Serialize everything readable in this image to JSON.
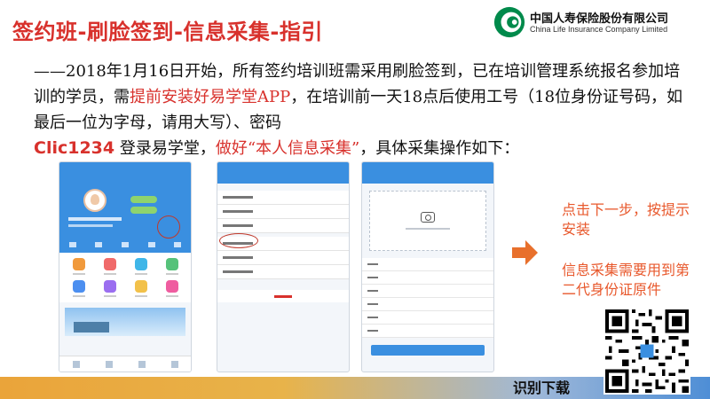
{
  "header": {
    "title": "签约班-刷脸签到-信息采集-指引"
  },
  "logo": {
    "name_cn": "中国人寿保险股份有限公司",
    "name_en": "China Life Insurance Company Limited"
  },
  "intro": {
    "part1": "——2018年1月16日开始，所有签约培训班需采用刷脸签到，已在培训管理系统报名参加培训的学员，需",
    "highlight1": "提前安装好易学堂APP",
    "part2": "，在培训前一天18点后使用工号（18位身份证号码，如最后一位为字母，请用大写）、密码",
    "password": "Clic1234",
    "part3": " 登录易学堂，",
    "highlight2": "做好“本人信息采集”",
    "part4": "，具体采集操作如下："
  },
  "side_notes": {
    "note1": "点击下一步，按提示安装",
    "note2": "信息采集需要用到第二代身份证原件"
  },
  "footer": {
    "download_label": "识别下载"
  },
  "colors": {
    "title_red": "#d8312c",
    "note_orange": "#e8582c",
    "app_blue": "#3a8fe0",
    "arrow_orange": "#e8702c",
    "logo_green": "#008a4b"
  },
  "icons": [
    "logo-mark-icon",
    "camera-icon",
    "right-arrow-icon",
    "qr-code-icon"
  ]
}
